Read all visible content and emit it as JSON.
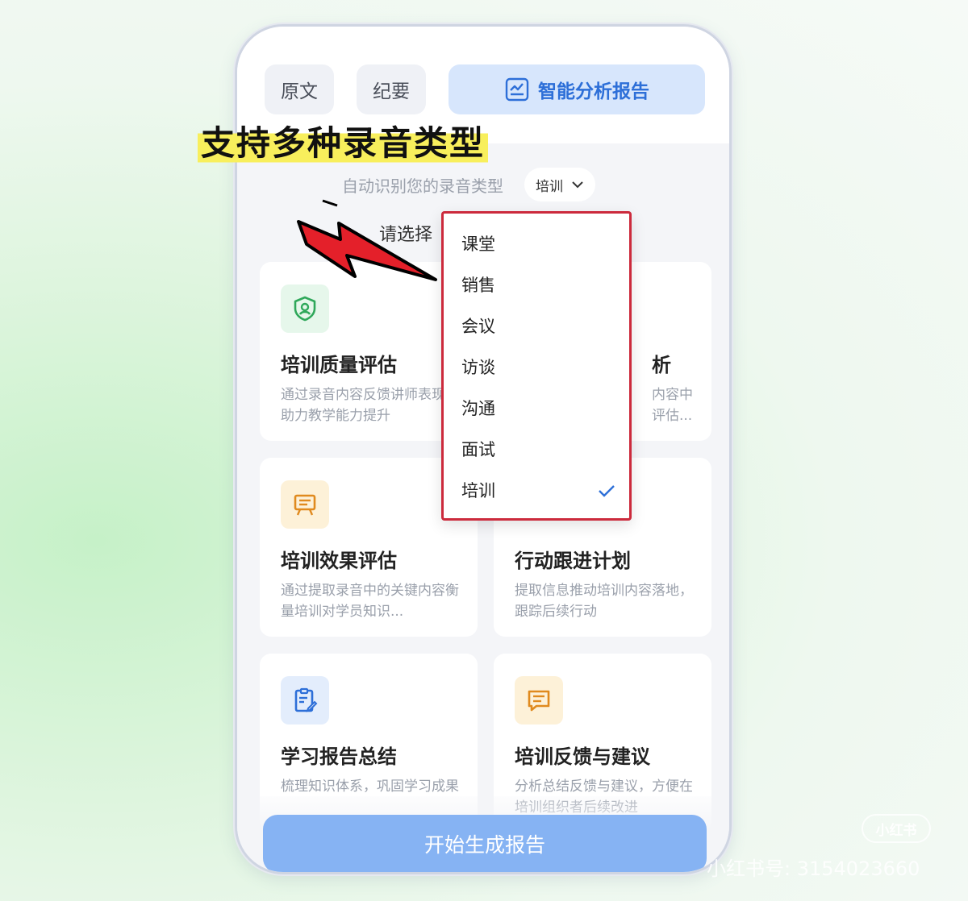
{
  "tabs": {
    "original": "原文",
    "summary": "纪要",
    "report": "智能分析报告"
  },
  "headline": "支持多种录音类型",
  "auto_detect": {
    "label": "自动识别您的录音类型",
    "selected_type": "培训"
  },
  "choose_label": "请选择",
  "dropdown": {
    "items": [
      "课堂",
      "销售",
      "会议",
      "访谈",
      "沟通",
      "面试",
      "培训"
    ],
    "selected": "培训"
  },
  "cards": [
    {
      "title": "培训质量评估",
      "desc": "通过录音内容反馈讲师表现，助力教学能力提升",
      "icon": "shield-person-icon",
      "color": "#2fa85a",
      "bg": "#e6f7eb"
    },
    {
      "title": "析",
      "desc": "内容中评估...",
      "icon": "",
      "color": "",
      "bg": ""
    },
    {
      "title": "培训效果评估",
      "desc": "通过提取录音中的关键内容衡量培训对学员知识...",
      "icon": "presentation-board-icon",
      "color": "#e08a1e",
      "bg": "#fdf1d8"
    },
    {
      "title": "行动跟进计划",
      "desc": "提取信息推动培训内容落地，跟踪后续行动",
      "icon": "",
      "color": "",
      "bg": ""
    },
    {
      "title": "学习报告总结",
      "desc": "梳理知识体系，巩固学习成果",
      "icon": "clipboard-edit-icon",
      "color": "#2d6fd8",
      "bg": "#e3edfc"
    },
    {
      "title": "培训反馈与建议",
      "desc": "分析总结反馈与建议，方便在培训组织者后续改进",
      "icon": "message-list-icon",
      "color": "#e08a1e",
      "bg": "#fdf1d8"
    }
  ],
  "start_button": "开始生成报告",
  "watermark": {
    "badge": "小红书",
    "text": "小红书号: 3154023660"
  },
  "colors": {
    "accent": "#2d6fd8",
    "dropdown_border": "#cc2a3c",
    "highlight": "#f8ef5c",
    "arrow": "#e4202a"
  }
}
